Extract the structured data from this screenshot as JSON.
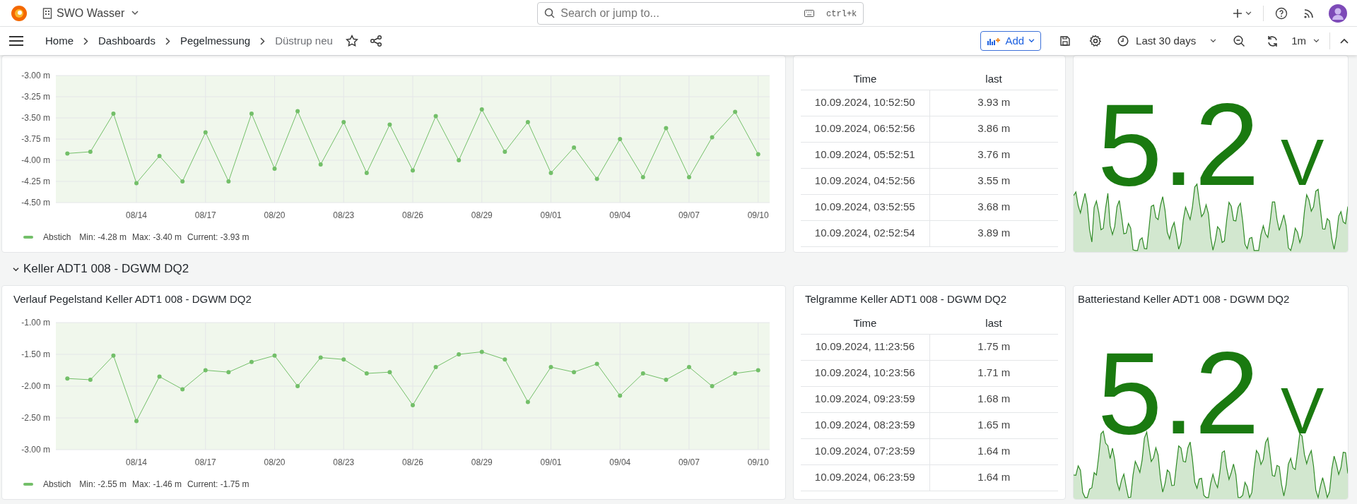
{
  "top_bar": {
    "org": "SWO Wasser",
    "search": {
      "placeholder": "Search or jump to...",
      "shortcut": "ctrl+k"
    }
  },
  "breadcrumbs": [
    {
      "label": "Home",
      "current": false
    },
    {
      "label": "Dashboards",
      "current": false
    },
    {
      "label": "Pegelmessung",
      "current": false
    },
    {
      "label": "Düstrup neu",
      "current": true
    }
  ],
  "toolbar": {
    "add_label": "Add",
    "time_range": "Last 30 days",
    "refresh_interval": "1m"
  },
  "sections": [
    {
      "graph": {
        "chart_data": {
          "type": "line",
          "categories": [
            null,
            null,
            null,
            "08/14",
            null,
            null,
            "08/17",
            null,
            null,
            "08/20",
            null,
            null,
            "08/23",
            null,
            null,
            "08/26",
            null,
            null,
            "08/29",
            null,
            null,
            "09/01",
            null,
            null,
            "09/04",
            null,
            null,
            "09/07",
            null,
            null,
            "09/10"
          ],
          "grid": true,
          "series": [
            {
              "name": "Abstich",
              "color": "#73bf69",
              "marker": true,
              "values": [
                -3.92,
                -3.9,
                -3.45,
                -4.27,
                -3.95,
                -4.25,
                -3.67,
                -4.25,
                -3.45,
                -4.1,
                -3.42,
                -4.05,
                -3.55,
                -4.15,
                -3.58,
                -4.12,
                -3.48,
                -4.0,
                -3.4,
                -3.9,
                -3.55,
                -4.15,
                -3.85,
                -4.22,
                -3.75,
                -4.2,
                -3.62,
                -4.2,
                -3.73,
                -3.43,
                -3.93
              ]
            }
          ],
          "ylim": [
            -4.5,
            -3.0
          ],
          "yticks": [
            {
              "value": -3.0,
              "label": "-3.00 m"
            },
            {
              "value": -3.25,
              "label": "-3.25 m"
            },
            {
              "value": -3.5,
              "label": "-3.50 m"
            },
            {
              "value": -3.75,
              "label": "-3.75 m"
            },
            {
              "value": -4.0,
              "label": "-4.00 m"
            },
            {
              "value": -4.25,
              "label": "-4.25 m"
            },
            {
              "value": -4.5,
              "label": "-4.50 m"
            }
          ]
        },
        "legend": {
          "stats": [
            "Min: -4.28 m",
            "Max: -3.40 m",
            "Current: -3.93 m"
          ]
        }
      },
      "table": {
        "columns": [
          "Time",
          "last"
        ],
        "rows": [
          [
            "10.09.2024, 10:52:50",
            "3.93 m"
          ],
          [
            "10.09.2024, 06:52:56",
            "3.86 m"
          ],
          [
            "10.09.2024, 05:52:51",
            "3.76 m"
          ],
          [
            "10.09.2024, 04:52:56",
            "3.55 m"
          ],
          [
            "10.09.2024, 03:52:55",
            "3.68 m"
          ],
          [
            "10.09.2024, 02:52:54",
            "3.89 m"
          ]
        ]
      },
      "stat": {
        "value": "5.2",
        "unit": "V",
        "color": "#1a7a10"
      }
    },
    {
      "header": {
        "title": "Keller ADT1 008 - DGWM DQ2",
        "expanded": true
      },
      "graph": {
        "title": "Verlauf Pegelstand Keller ADT1 008 - DGWM DQ2",
        "chart_data": {
          "type": "line",
          "categories": [
            null,
            null,
            null,
            "08/14",
            null,
            null,
            "08/17",
            null,
            null,
            "08/20",
            null,
            null,
            "08/23",
            null,
            null,
            "08/26",
            null,
            null,
            "08/29",
            null,
            null,
            "09/01",
            null,
            null,
            "09/04",
            null,
            null,
            "09/07",
            null,
            null,
            "09/10"
          ],
          "grid": true,
          "series": [
            {
              "name": "Abstich",
              "color": "#73bf69",
              "marker": true,
              "values": [
                -1.88,
                -1.9,
                -1.52,
                -2.55,
                -1.85,
                -2.05,
                -1.75,
                -1.78,
                -1.62,
                -1.52,
                -2.0,
                -1.55,
                -1.58,
                -1.8,
                -1.78,
                -2.3,
                -1.7,
                -1.5,
                -1.46,
                -1.58,
                -2.25,
                -1.7,
                -1.78,
                -1.65,
                -2.15,
                -1.8,
                -1.9,
                -1.7,
                -2.0,
                -1.8,
                -1.75
              ]
            }
          ],
          "ylim": [
            -3.0,
            -1.0
          ],
          "yticks": [
            {
              "value": -1.0,
              "label": "-1.00 m"
            },
            {
              "value": -1.5,
              "label": "-1.50 m"
            },
            {
              "value": -2.0,
              "label": "-2.00 m"
            },
            {
              "value": -2.5,
              "label": "-2.50 m"
            },
            {
              "value": -3.0,
              "label": "-3.00 m"
            }
          ]
        },
        "legend": {
          "stats": [
            "Min: -2.55 m",
            "Max: -1.46 m",
            "Current: -1.75 m"
          ]
        }
      },
      "table": {
        "title": "Telgramme Keller ADT1 008 - DGWM DQ2",
        "columns": [
          "Time",
          "last"
        ],
        "rows": [
          [
            "10.09.2024, 11:23:56",
            "1.75 m"
          ],
          [
            "10.09.2024, 10:23:56",
            "1.71 m"
          ],
          [
            "10.09.2024, 09:23:59",
            "1.68 m"
          ],
          [
            "10.09.2024, 08:23:59",
            "1.65 m"
          ],
          [
            "10.09.2024, 07:23:59",
            "1.64 m"
          ],
          [
            "10.09.2024, 06:23:59",
            "1.64 m"
          ]
        ]
      },
      "stat": {
        "title": "Batteriestand Keller ADT1 008 - DGWM DQ2",
        "value": "5.2",
        "unit": "V",
        "color": "#1a7a10"
      }
    }
  ]
}
